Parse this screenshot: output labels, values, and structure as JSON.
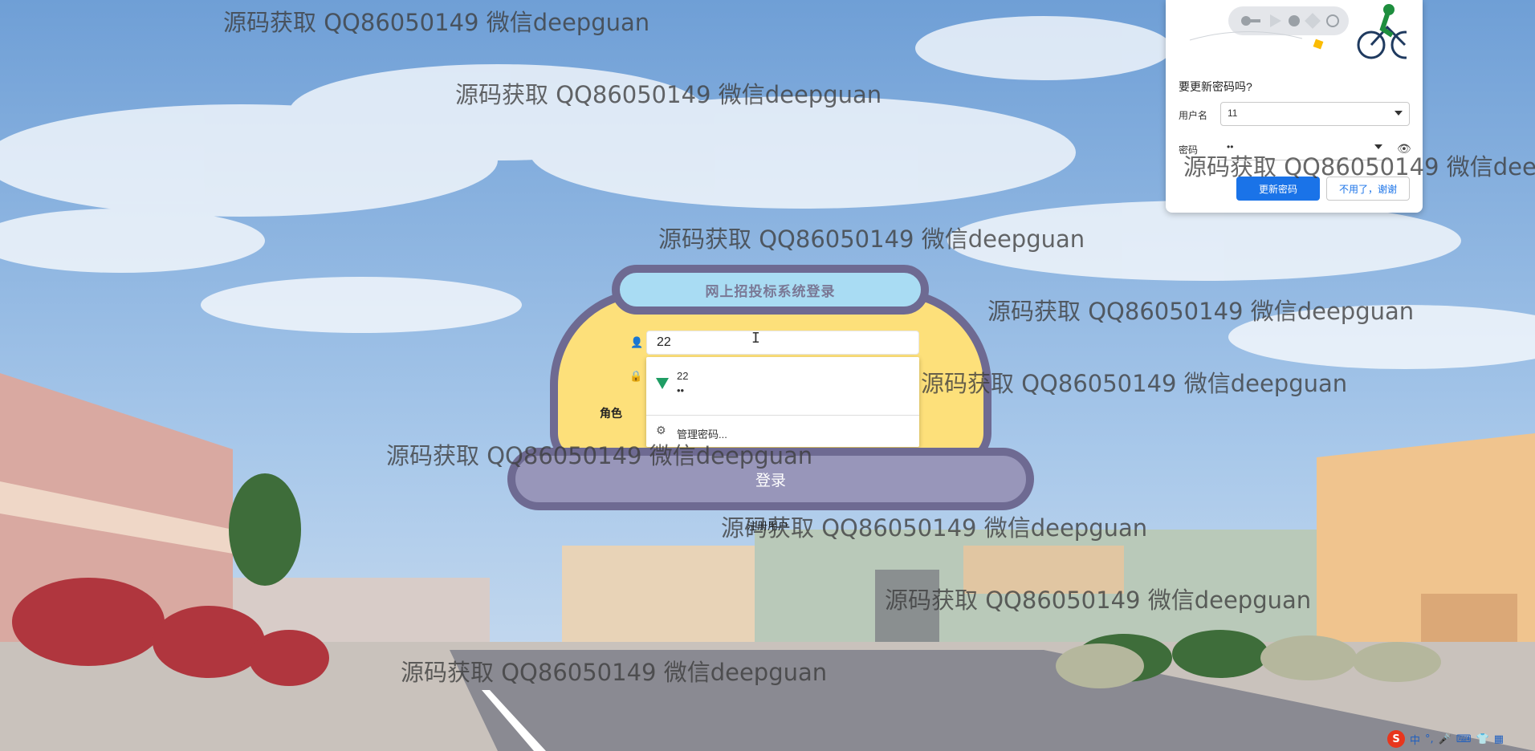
{
  "login": {
    "title": "网上招投标系统登录",
    "username_value": "22",
    "role_label": "角色",
    "login_button": "登录",
    "register_link": "注册用户"
  },
  "autofill": {
    "entry_user": "22",
    "entry_password": "••",
    "manage_label": "管理密码..."
  },
  "password_bubble": {
    "title": "要更新密码吗?",
    "username_label": "用户名",
    "username_value": "11",
    "password_label": "密码",
    "password_value": "••",
    "update_button": "更新密码",
    "dismiss_button": "不用了，谢谢"
  },
  "watermark_text": "源码获取 QQ86050149 微信deepguan",
  "ime": {
    "logo": "S",
    "items": [
      "中",
      "°,",
      "🎤",
      "⌨",
      "👕",
      "▦"
    ]
  },
  "colors": {
    "card": "#fde07a",
    "border": "#6e6a92",
    "title_bg": "#a9dcf3",
    "button_bg": "#9896ba",
    "primary": "#1a73e8"
  }
}
